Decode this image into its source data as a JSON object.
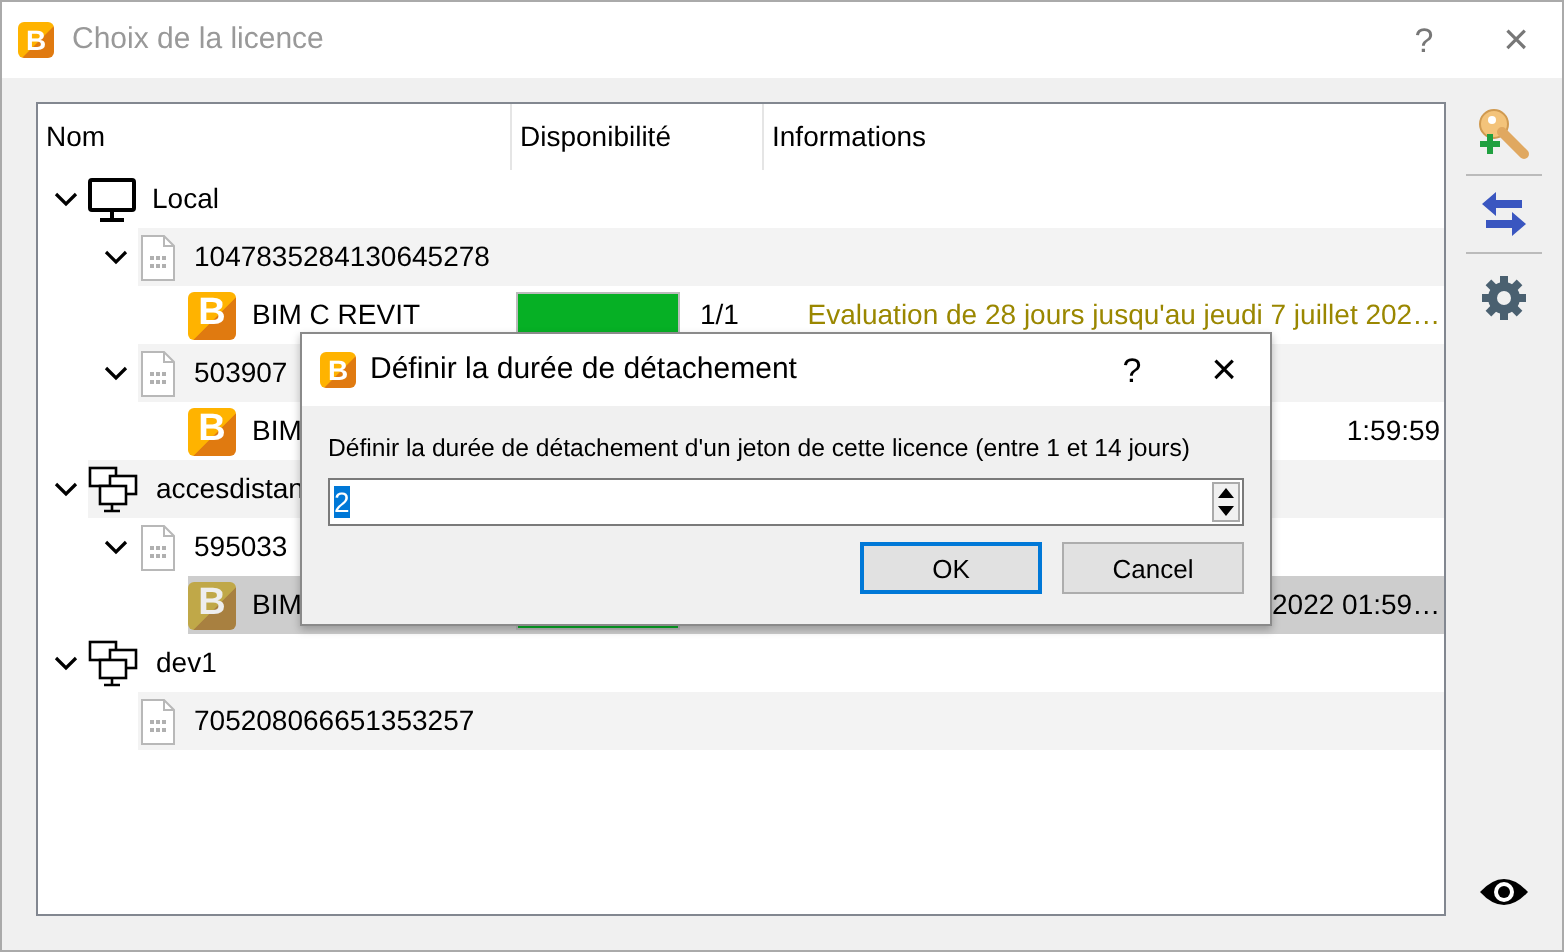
{
  "window": {
    "logo": "B",
    "title": "Choix de la licence",
    "help": "?",
    "close": "×"
  },
  "tree": {
    "columns": [
      "Nom",
      "Disponibilité",
      "Informations"
    ],
    "items": [
      {
        "kind": "local",
        "label": "Local",
        "expanded": true,
        "children": [
          {
            "kind": "key",
            "label": "1047835284130645278",
            "expanded": true,
            "children": [
              {
                "kind": "license",
                "logo": "B",
                "label": "BIM C REVIT",
                "selected": false,
                "level": 1,
                "reading": "1/1",
                "info": "Evaluation de 28 jours jusqu'au jeudi 7 juillet 202…",
                "color": "#9a8700"
              }
            ]
          },
          {
            "kind": "key",
            "label": "503907",
            "expanded": true,
            "children": [
              {
                "kind": "license",
                "logo": "B",
                "label": "BIM",
                "selected": false,
                "info": "1:59:59",
                "color": "#000000"
              }
            ]
          }
        ]
      },
      {
        "kind": "remote",
        "label": "accesdistan",
        "expanded": true,
        "children": [
          {
            "kind": "key",
            "label": "595033",
            "expanded": true,
            "children": [
              {
                "kind": "license",
                "logo": "B",
                "label": "BIM",
                "selected": true,
                "level": 1,
                "info": "2022 01:59…",
                "color": "#000000"
              }
            ]
          }
        ]
      },
      {
        "kind": "remote",
        "label": "dev1",
        "expanded": true,
        "children": [
          {
            "kind": "key",
            "label": "705208066651353257"
          }
        ]
      }
    ]
  },
  "dialog": {
    "logo": "B",
    "title": "Définir la durée de détachement",
    "help": "?",
    "close": "×",
    "label": "Définir la durée de détachement d'un jeton de cette licence (entre 1 et 14 jours)",
    "value": "2",
    "buttons": [
      {
        "label": "OK",
        "default": true
      },
      {
        "label": "Cancel",
        "default": false
      }
    ]
  }
}
